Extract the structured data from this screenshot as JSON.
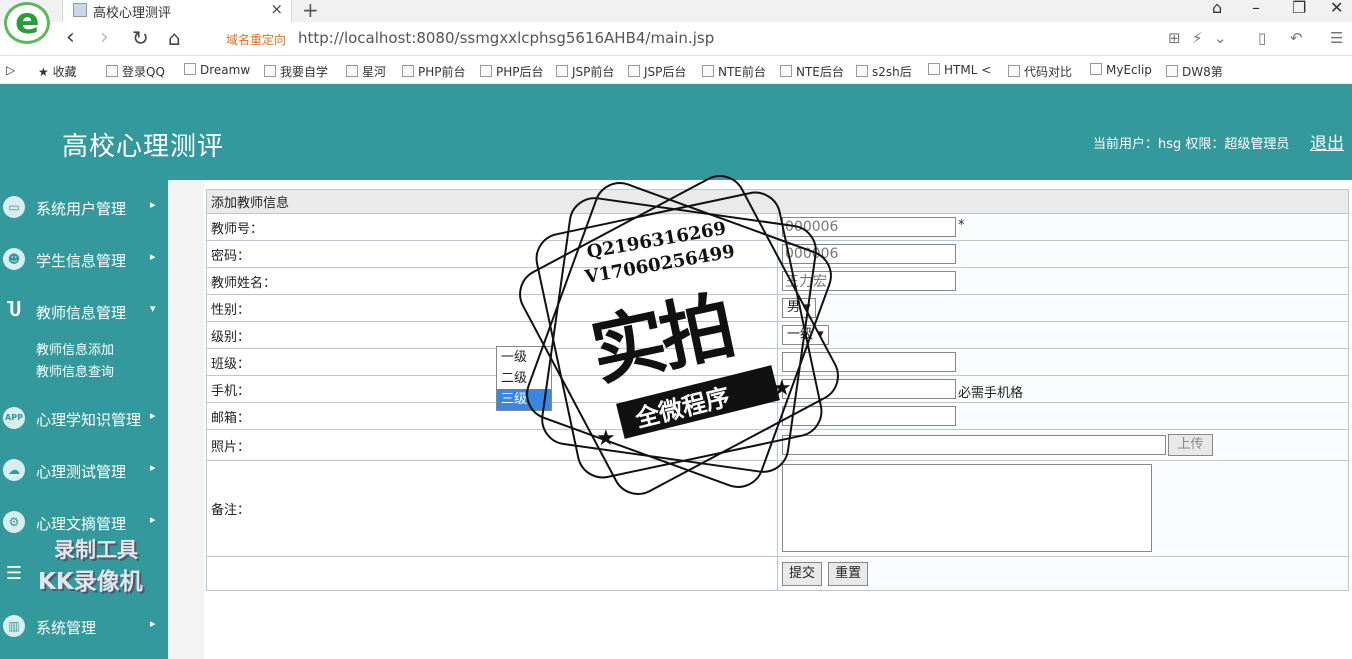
{
  "browser": {
    "tab_title": "高校心理测评",
    "redirect_label": "域名重定向",
    "url": "http://localhost:8080/ssmgxxlcphsg5616AHB4/main.jsp",
    "bookmarks": [
      "收藏",
      "登录QQ",
      "Dreamw",
      "我要自学",
      "星河",
      "PHP前台",
      "PHP后台",
      "JSP前台",
      "JSP后台",
      "NTE前台",
      "NTE后台",
      "s2sh后",
      "HTML <",
      "代码对比",
      "MyEclip",
      "DW8第"
    ]
  },
  "header": {
    "title": "高校心理测评",
    "user_info": "当前用户：hsg  权限：超级管理员",
    "logout": "退出"
  },
  "sidebar": {
    "items": [
      {
        "label": "系统用户管理",
        "icon": "monitor-icon",
        "arrow": "▸"
      },
      {
        "label": "学生信息管理",
        "icon": "user-gear-icon",
        "arrow": "▸"
      },
      {
        "label": "教师信息管理",
        "icon": "teacher-icon",
        "arrow": "▾"
      },
      {
        "label": "心理学知识管理",
        "icon": "app-icon",
        "arrow": "▸"
      },
      {
        "label": "心理测试管理",
        "icon": "cloud-icon",
        "arrow": "▸"
      },
      {
        "label": "心理文摘管理",
        "icon": "gear-icon",
        "arrow": "▸"
      },
      {
        "label": "系统管理",
        "icon": "chart-icon",
        "arrow": "▸"
      }
    ],
    "submenu": [
      "教师信息添加",
      "教师信息查询"
    ]
  },
  "form": {
    "caption": "添加教师信息",
    "fields": {
      "teacher_no": {
        "label": "教师号：",
        "value": "000006",
        "required_mark": "*"
      },
      "password": {
        "label": "密码：",
        "value": "000006"
      },
      "name": {
        "label": "教师姓名：",
        "value": "王力宏"
      },
      "gender": {
        "label": "性别：",
        "value": "男"
      },
      "level": {
        "label": "级别：",
        "value": "一级",
        "options": [
          "一级",
          "二级",
          "三级"
        ],
        "highlighted": "三级"
      },
      "class": {
        "label": "班级："
      },
      "phone": {
        "label": "手机：",
        "hint": "必需手机格"
      },
      "email": {
        "label": "邮箱："
      },
      "photo": {
        "label": "照片：",
        "upload_label": "上传"
      },
      "notes": {
        "label": "备注："
      }
    },
    "submit_label": "提交",
    "reset_label": "重置"
  },
  "watermarks": {
    "stamp_line1": "Q2196316269",
    "stamp_line2": "V17060256499",
    "stamp_big": "实拍",
    "stamp_sub": "全微程序",
    "recorder_l1": "录制工具",
    "recorder_l2": "KK录像机"
  },
  "colors": {
    "theme": "#33999c",
    "selected_option": "#3a86e0"
  }
}
